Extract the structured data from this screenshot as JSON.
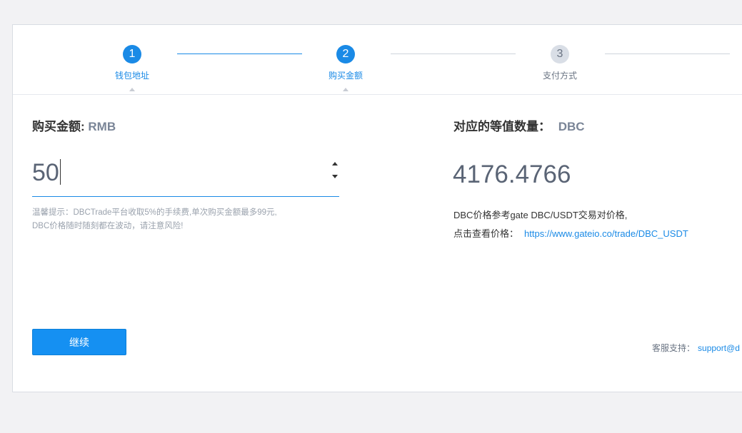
{
  "stepper": {
    "steps": [
      {
        "number": "1",
        "label": "钱包地址"
      },
      {
        "number": "2",
        "label": "购买金额"
      },
      {
        "number": "3",
        "label": "支付方式"
      }
    ]
  },
  "purchase": {
    "title": "购买金额:",
    "unit": "RMB",
    "amount": "50",
    "tip_line1": "温馨提示：DBCTrade平台收取5%的手续费,单次购买金额最多99元,",
    "tip_line2": "DBC价格随时随刻都在波动，请注意风险!",
    "continue_label": "继续"
  },
  "equivalent": {
    "title": "对应的等值数量：",
    "unit": "DBC",
    "quantity": "4176.4766",
    "ref_line1": "DBC价格参考gate DBC/USDT交易对价格,",
    "ref_line2_label": "点击查看价格：",
    "ref_link": "https://www.gateio.co/trade/DBC_USDT"
  },
  "support": {
    "label": "客服支持：",
    "email": "support@d"
  },
  "colors": {
    "accent": "#1a8ae6",
    "button": "#1590f2"
  }
}
